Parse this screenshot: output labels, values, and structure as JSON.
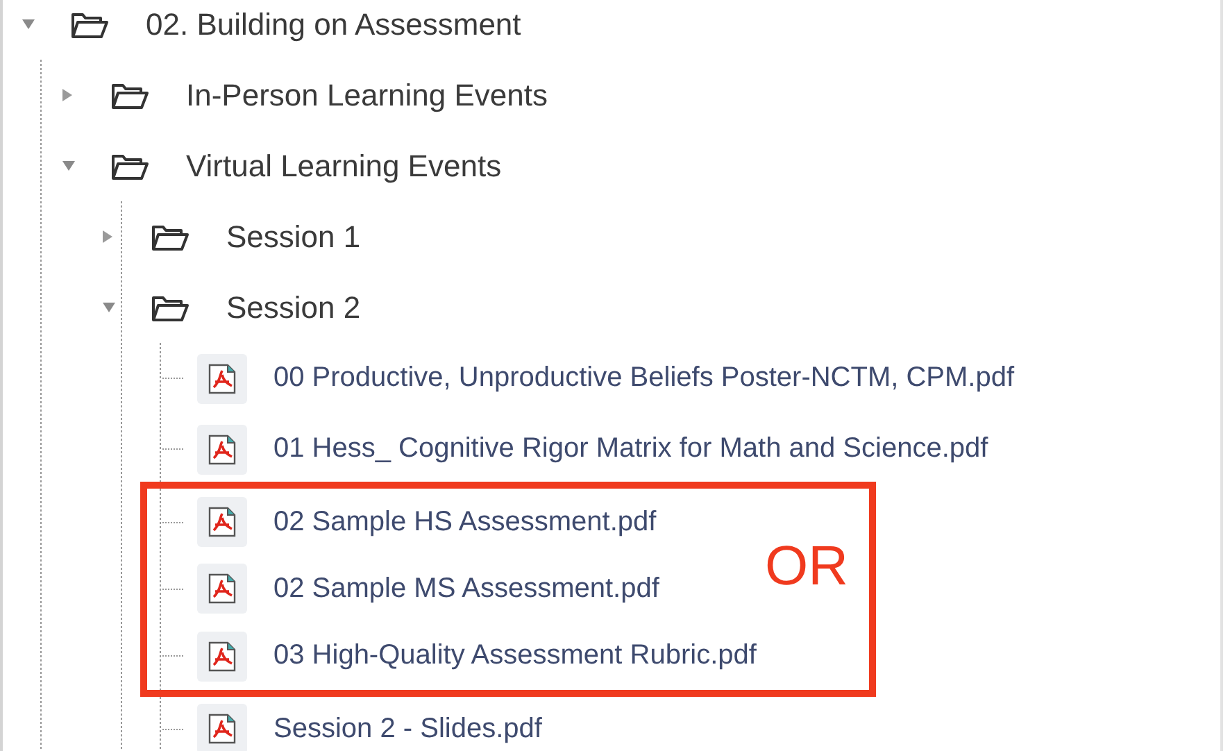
{
  "tree": [
    {
      "kind": "folder",
      "label": "02. Building on Assessment",
      "expanded": true,
      "children": [
        {
          "kind": "folder",
          "label": "In-Person Learning Events",
          "expanded": false
        },
        {
          "kind": "folder",
          "label": "Virtual Learning Events",
          "expanded": true,
          "children": [
            {
              "kind": "folder",
              "label": "Session 1",
              "expanded": false
            },
            {
              "kind": "folder",
              "label": "Session 2",
              "expanded": true,
              "children": [
                {
                  "kind": "file",
                  "label": "00 Productive, Unproductive Beliefs Poster-NCTM, CPM.pdf",
                  "highlighted": false
                },
                {
                  "kind": "file",
                  "label": "01 Hess_ Cognitive Rigor Matrix for Math and Science.pdf",
                  "highlighted": false
                },
                {
                  "kind": "file",
                  "label": "02 Sample HS Assessment.pdf",
                  "highlighted": true
                },
                {
                  "kind": "file",
                  "label": "02 Sample MS Assessment.pdf",
                  "highlighted": true
                },
                {
                  "kind": "file",
                  "label": "03 High-Quality Assessment Rubric.pdf",
                  "highlighted": true
                },
                {
                  "kind": "file",
                  "label": "Session 2 - Slides.pdf",
                  "highlighted": false
                }
              ]
            }
          ]
        }
      ]
    }
  ],
  "annotation": {
    "label": "OR"
  }
}
